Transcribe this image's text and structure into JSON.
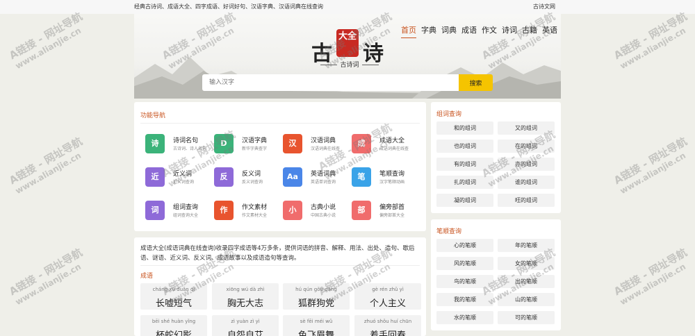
{
  "topbar": {
    "tagline": "经典古诗词、成语大全、四字成语、好词好句、汉语字典、汉语词典在线查询",
    "right_link": "古诗文网"
  },
  "logo": {
    "left": "古",
    "seal": "大全",
    "right": "诗",
    "sub": "古诗词"
  },
  "nav": [
    "首页",
    "字典",
    "词典",
    "成语",
    "作文",
    "诗词",
    "古籍",
    "英语"
  ],
  "search": {
    "placeholder": "输入汉字",
    "button": "搜索"
  },
  "func_nav": {
    "title": "功能导航",
    "items": [
      {
        "name": "诗词名句",
        "desc": "古诗词、诗人名句",
        "icon": "诗",
        "color": "#3bb37a"
      },
      {
        "name": "汉语字典",
        "desc": "新华字典查字",
        "icon": "D",
        "color": "#3bb37a"
      },
      {
        "name": "汉语词典",
        "desc": "汉语词典在线查",
        "icon": "汉",
        "color": "#e8542e"
      },
      {
        "name": "成语大全",
        "desc": "成语词典在线查",
        "icon": "成",
        "color": "#f06c6c"
      },
      {
        "name": "近义词",
        "desc": "近义词查询",
        "icon": "近",
        "color": "#8e6ad8"
      },
      {
        "name": "反义词",
        "desc": "反义词查询",
        "icon": "反",
        "color": "#8e6ad8"
      },
      {
        "name": "英语词典",
        "desc": "英语单词查询",
        "icon": "Aa",
        "color": "#4a86e8"
      },
      {
        "name": "笔顺查询",
        "desc": "汉字笔顺动画",
        "icon": "笔",
        "color": "#3aa3e8"
      },
      {
        "name": "组词查询",
        "desc": "组词查询大全",
        "icon": "词",
        "color": "#8e6ad8"
      },
      {
        "name": "作文素材",
        "desc": "作文素材大全",
        "icon": "作",
        "color": "#e8542e"
      },
      {
        "name": "古典小说",
        "desc": "中国古典小说",
        "icon": "小",
        "color": "#f06c6c"
      },
      {
        "name": "偏旁部首",
        "desc": "偏旁部首大全",
        "icon": "部",
        "color": "#f06c6c"
      }
    ]
  },
  "intro": {
    "text": "成语大全(成语词典在线查询)收录四字成语等4万多条，提供词语的拼音、解释、用法、出处、造句、歇后语、谜语、近义词、反义词、成语故事以及成语造句等查询。",
    "section_title": "成语",
    "idioms": [
      {
        "py": "cháng xū duǎn qì",
        "word": "长嘘短气"
      },
      {
        "py": "xiōng wú dà zhì",
        "word": "胸无大志"
      },
      {
        "py": "hú qún gǒu dǎng",
        "word": "狐群狗党"
      },
      {
        "py": "gè rén zhǔ yì",
        "word": "个人主义"
      },
      {
        "py": "bēi shé huàn yǐng",
        "word": "杯蛇幻影"
      },
      {
        "py": "zì yuàn zì yì",
        "word": "自怨自艾"
      },
      {
        "py": "sè fēi méi wǔ",
        "word": "色飞眉舞"
      },
      {
        "py": "zhuó shǒu huí chūn",
        "word": "着手回春"
      }
    ]
  },
  "zuci": {
    "title": "组词查询",
    "items": [
      "和的组词",
      "又的组词",
      "也的组词",
      "在的组词",
      "有的组词",
      "亦的组词",
      "扎的组词",
      "谁的组词",
      "凝的组词",
      "旺的组词"
    ]
  },
  "bishun": {
    "title": "笔顺查询",
    "items": [
      "心的笔顺",
      "年的笔顺",
      "风的笔顺",
      "女的笔顺",
      "鸟的笔顺",
      "出的笔顺",
      "我的笔顺",
      "山的笔顺",
      "水的笔顺",
      "可的笔顺"
    ]
  },
  "watermark": {
    "line1": "A链接 - 网址导航",
    "line2": "www.alianjie.cn"
  }
}
